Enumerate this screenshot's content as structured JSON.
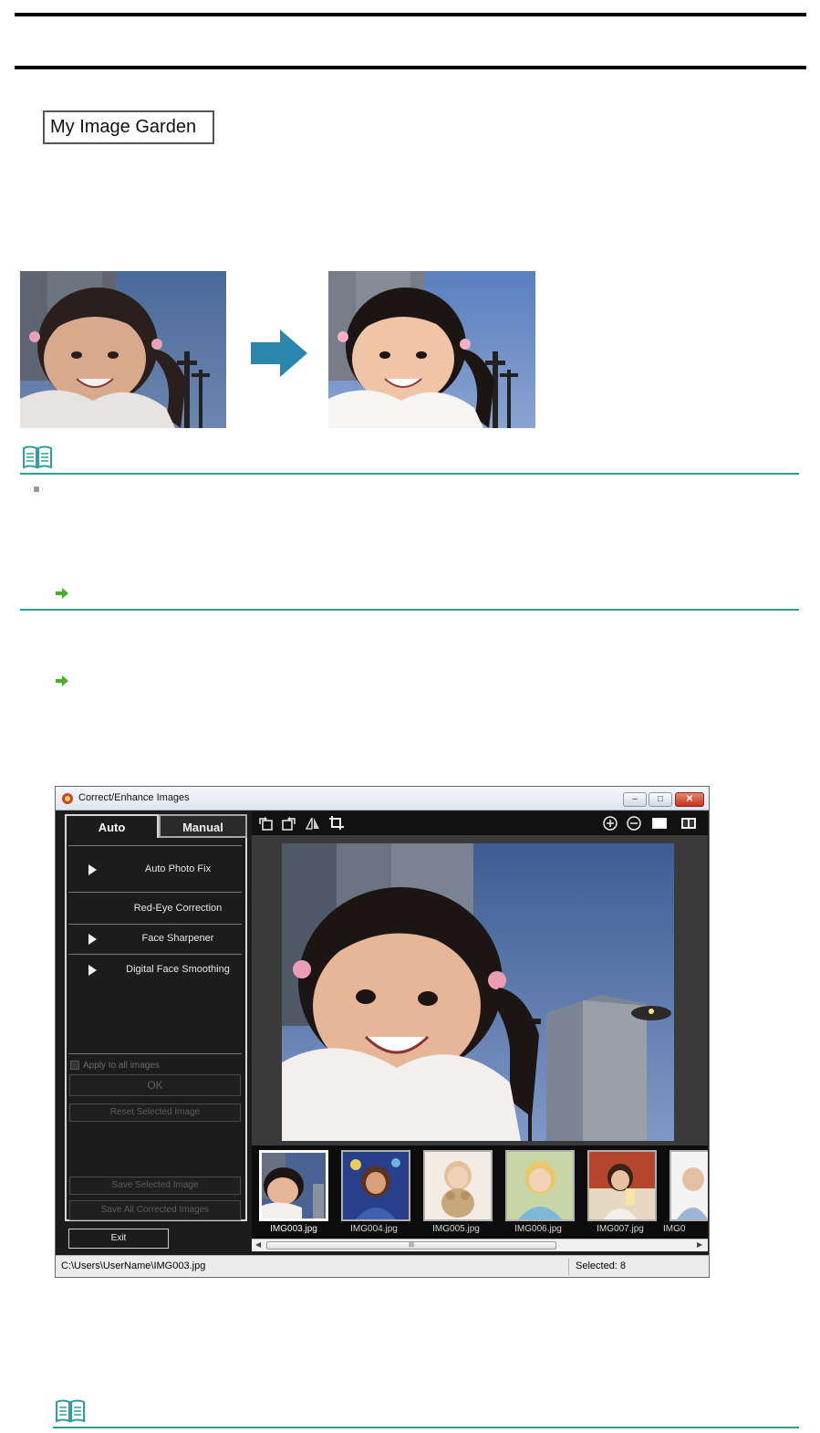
{
  "app_label": "My Image Garden",
  "window": {
    "title": "Correct/Enhance Images",
    "controls": {
      "minimize": "–",
      "maximize": "□",
      "close": "✕"
    }
  },
  "tabs": {
    "auto": "Auto",
    "manual": "Manual"
  },
  "functions": [
    {
      "label": "Auto Photo Fix",
      "has_arrow": true
    },
    {
      "label": "Red-Eye Correction",
      "has_arrow": false
    },
    {
      "label": "Face Sharpener",
      "has_arrow": true
    },
    {
      "label": "Digital Face Smoothing",
      "has_arrow": true
    }
  ],
  "apply_all_label": "Apply to all images",
  "buttons": {
    "ok": "OK",
    "reset": "Reset Selected Image",
    "save_selected": "Save Selected Image",
    "save_all": "Save All Corrected Images",
    "exit": "Exit"
  },
  "toolbar_icons": [
    "rotate-left-icon",
    "rotate-right-icon",
    "flip-icon",
    "crop-icon",
    "zoom-in-icon",
    "zoom-out-icon",
    "full-screen-icon",
    "compare-icon"
  ],
  "thumbnails": [
    {
      "name": "IMG003.jpg",
      "selected": true
    },
    {
      "name": "IMG004.jpg",
      "selected": false
    },
    {
      "name": "IMG005.jpg",
      "selected": false
    },
    {
      "name": "IMG006.jpg",
      "selected": false
    },
    {
      "name": "IMG007.jpg",
      "selected": false
    },
    {
      "name": "IMG0",
      "selected": false
    }
  ],
  "scrollbar_grip": "III",
  "status": {
    "path": "C:\\Users\\UserName\\IMG003.jpg",
    "selected": "Selected: 8"
  },
  "colors": {
    "note_line": "#2f9f9a",
    "arrow_blue": "#2a86ad",
    "link_arrow_green": "#4caf2a"
  }
}
